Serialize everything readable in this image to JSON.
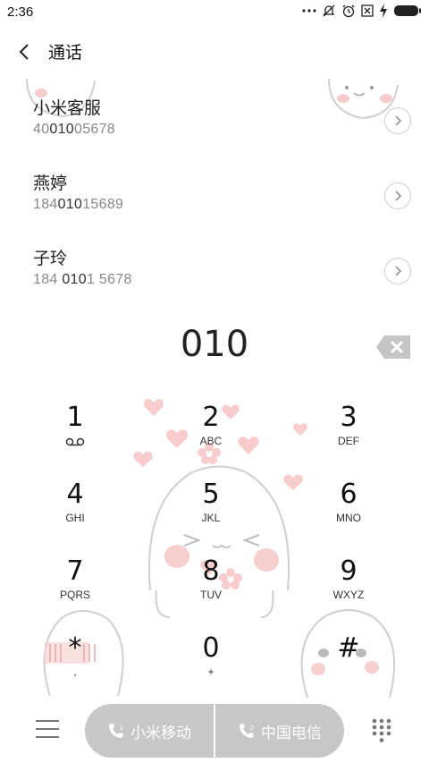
{
  "status_bar": {
    "time": "2:36",
    "icons": [
      "more-dots-icon",
      "mute-bell-icon",
      "alarm-icon",
      "no-sim-icon",
      "charging-icon",
      "battery-icon"
    ]
  },
  "header": {
    "title": "通话",
    "back_icon": "chevron-left-icon"
  },
  "contacts": [
    {
      "name": "小米客服",
      "num_pre": "40",
      "num_hl": "010",
      "num_post": "05678"
    },
    {
      "name": "燕婷",
      "num_pre": "184",
      "num_hl": "010",
      "num_post": "15689"
    },
    {
      "name": "子玲",
      "num_pre": "184 ",
      "num_hl": "010",
      "num_post": "1 5678"
    }
  ],
  "dialer": {
    "input": "010",
    "keys": [
      {
        "digit": "1",
        "sub": ""
      },
      {
        "digit": "2",
        "sub": "ABC"
      },
      {
        "digit": "3",
        "sub": "DEF"
      },
      {
        "digit": "4",
        "sub": "GHI"
      },
      {
        "digit": "5",
        "sub": "JKL"
      },
      {
        "digit": "6",
        "sub": "MNO"
      },
      {
        "digit": "7",
        "sub": "PQRS"
      },
      {
        "digit": "8",
        "sub": "TUV"
      },
      {
        "digit": "9",
        "sub": "WXYZ"
      },
      {
        "digit": "*",
        "sub": ","
      },
      {
        "digit": "0",
        "sub": "+"
      },
      {
        "digit": "#",
        "sub": ""
      }
    ]
  },
  "call_buttons": {
    "sim1_label": "小米移动",
    "sim2_label": "中国电信"
  },
  "colors": {
    "call_bar": "#c7c7c7",
    "heart": "#f7c7c7",
    "text": "#222222"
  }
}
